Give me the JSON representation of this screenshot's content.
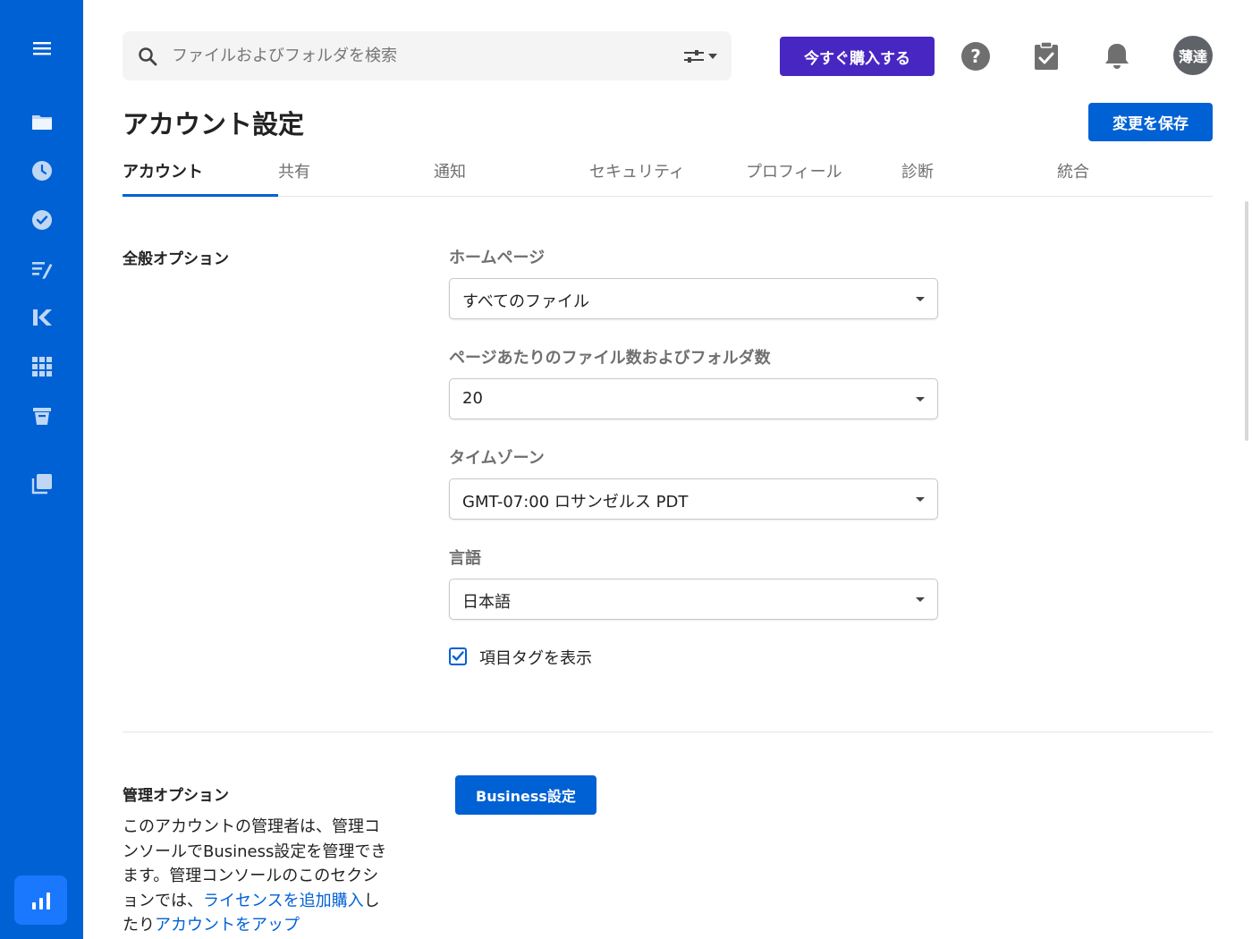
{
  "sidebar": {
    "items": [
      {
        "icon": "hamburger-menu-icon"
      },
      {
        "icon": "folder-icon"
      },
      {
        "icon": "clock-icon"
      },
      {
        "icon": "check-circle-icon"
      },
      {
        "icon": "notes-icon"
      },
      {
        "icon": "relay-icon"
      },
      {
        "icon": "apps-grid-icon"
      },
      {
        "icon": "trash-icon"
      },
      {
        "icon": "copy-icon"
      },
      {
        "icon": "insights-chart-icon"
      }
    ],
    "bg_color": "#0061d5"
  },
  "header": {
    "search_placeholder": "ファイルおよびフォルダを検索",
    "buy_label": "今すぐ購入する",
    "avatar_initials": "薄達"
  },
  "page": {
    "title": "アカウント設定",
    "save_label": "変更を保存"
  },
  "tabs": [
    {
      "label": "アカウント",
      "active": true
    },
    {
      "label": "共有",
      "active": false
    },
    {
      "label": "通知",
      "active": false
    },
    {
      "label": "セキュリティ",
      "active": false
    },
    {
      "label": "プロフィール",
      "active": false
    },
    {
      "label": "診断",
      "active": false
    },
    {
      "label": "統合",
      "active": false
    }
  ],
  "general": {
    "title": "全般オプション",
    "fields": [
      {
        "label": "ホームページ",
        "value": "すべてのファイル"
      },
      {
        "label": "ページあたりのファイル数およびフォルダ数",
        "value": "20"
      },
      {
        "label": "タイムゾーン",
        "value": "GMT-07:00 ロサンゼルス PDT"
      },
      {
        "label": "言語",
        "value": "日本語"
      }
    ],
    "checkbox": {
      "label": "項目タグを表示",
      "checked": true
    }
  },
  "admin": {
    "title": "管理オプション",
    "desc_part1": "このアカウントの管理者は、管理コンソールでBusiness設定を管理できます。管理コンソールのこのセクションでは、",
    "link1": "ライセンスを追加購入",
    "desc_part2": "したり",
    "link2": "アカウントをアップ",
    "business_button": "Business設定"
  },
  "colors": {
    "primary": "#0061d5",
    "purple": "#4826c2"
  }
}
